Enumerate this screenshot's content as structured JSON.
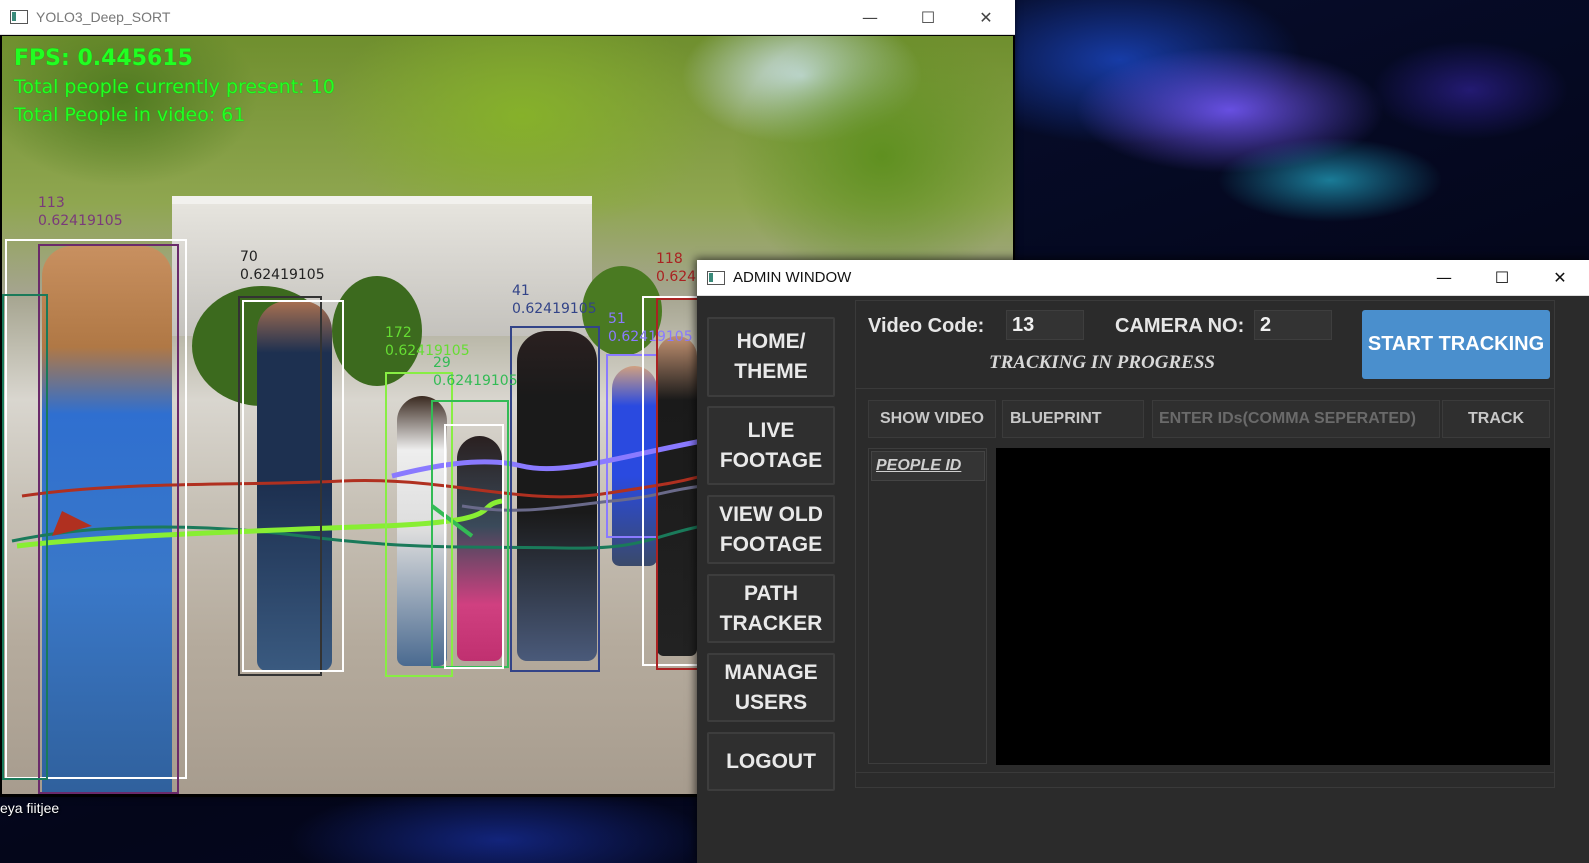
{
  "desktop": {
    "label": "eya fiitjee"
  },
  "video_window": {
    "title": "YOLO3_Deep_SORT",
    "controls": {
      "minimize": "—",
      "maximize": "☐",
      "close": "✕"
    },
    "overlay": {
      "fps": "FPS: 0.445615",
      "current": "Total people currently present: 10",
      "total": "Total People in video: 61"
    },
    "detections": [
      {
        "id": "113",
        "score": "0.62419105",
        "color": "#6a2a6a"
      },
      {
        "id": "70",
        "score": "0.62419105",
        "color": "#222222"
      },
      {
        "id": "172",
        "score": "0.62419105",
        "color": "#66dd33"
      },
      {
        "id": "29",
        "score": "0.62419105",
        "color": "#33bb55"
      },
      {
        "id": "41",
        "score": "0.62419105",
        "color": "#334488"
      },
      {
        "id": "51",
        "score": "0.62419105",
        "color": "#8a7aff"
      },
      {
        "id": "118",
        "score": "0.624",
        "color": "#aa2222"
      }
    ]
  },
  "admin_window": {
    "title": "ADMIN WINDOW",
    "controls": {
      "minimize": "—",
      "maximize": "☐",
      "close": "✕"
    },
    "nav": [
      {
        "label": "HOME/\nTHEME"
      },
      {
        "label": "LIVE\nFOOTAGE"
      },
      {
        "label": "VIEW OLD\nFOOTAGE"
      },
      {
        "label": "PATH\nTRACKER"
      },
      {
        "label": "MANAGE\nUSERS"
      },
      {
        "label": "LOGOUT"
      }
    ],
    "video_code_label": "Video Code:",
    "video_code_value": "13",
    "camera_label": "CAMERA NO:",
    "camera_value": "2",
    "start_button": "START TRACKING",
    "status": "TRACKING IN PROGRESS",
    "toolbar": {
      "show_video": "SHOW VIDEO",
      "blueprint": "BLUEPRINT",
      "ids_placeholder": "ENTER IDs(COMMA SEPERATED)",
      "track": "TRACK"
    },
    "people_header": "PEOPLE ID",
    "accent_color": "#4a8fcd"
  }
}
